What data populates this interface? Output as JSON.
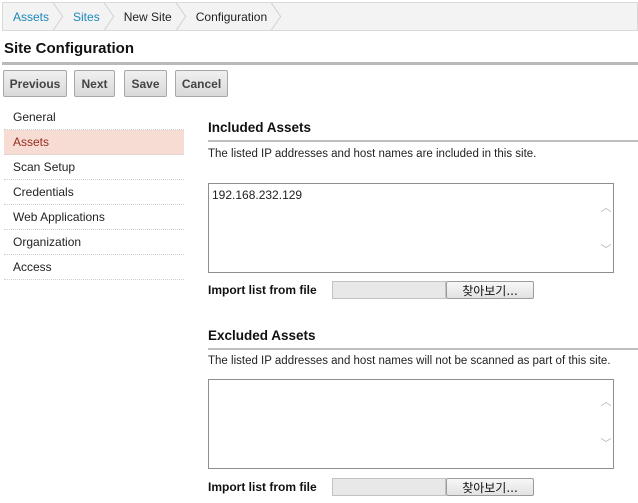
{
  "breadcrumb": {
    "items": [
      {
        "label": "Assets"
      },
      {
        "label": "Sites"
      },
      {
        "label": "New Site"
      },
      {
        "label": "Configuration"
      }
    ]
  },
  "page": {
    "title": "Site Configuration"
  },
  "toolbar": {
    "previous_label": "Previous",
    "next_label": "Next",
    "save_label": "Save",
    "cancel_label": "Cancel"
  },
  "sidebar": {
    "items": [
      {
        "label": "General"
      },
      {
        "label": "Assets",
        "active": true
      },
      {
        "label": "Scan Setup"
      },
      {
        "label": "Credentials"
      },
      {
        "label": "Web Applications"
      },
      {
        "label": "Organization"
      },
      {
        "label": "Access"
      }
    ]
  },
  "included": {
    "title": "Included Assets",
    "description": "The listed IP addresses and host names are included in this site.",
    "value": "192.168.232.129",
    "import_label": "Import list from file",
    "browse_label": "찾아보기..."
  },
  "excluded": {
    "title": "Excluded Assets",
    "description": "The listed IP addresses and host names will not be scanned as part of this site.",
    "value": "",
    "import_label": "Import list from file",
    "browse_label": "찾아보기..."
  },
  "colors": {
    "link": "#1a87b8",
    "active_bg": "#f7dcd4",
    "active_text": "#9a2b1d"
  },
  "icons": [
    "scroll-up-icon",
    "scroll-down-icon"
  ]
}
